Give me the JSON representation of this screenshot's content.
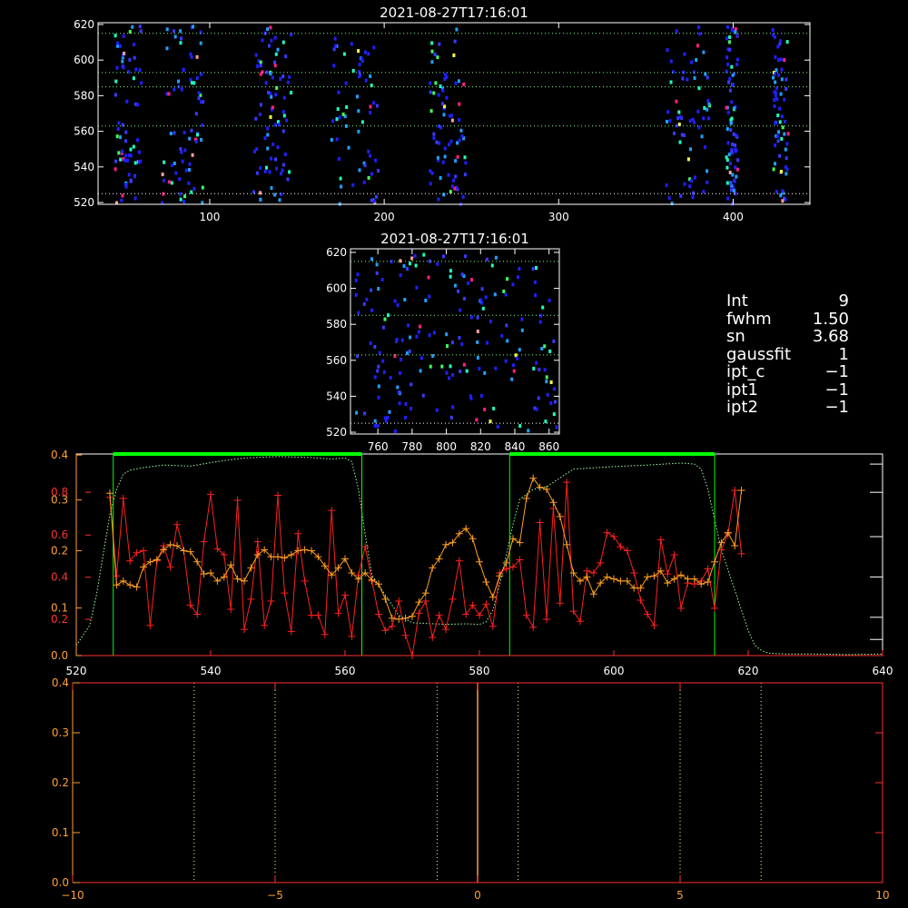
{
  "colors": {
    "background": "#000000",
    "frame": "#ffffff",
    "pixels": [
      "#2020ff",
      "#3a3aff",
      "#20a0ff",
      "#20ffc0",
      "#40ff60",
      "#ff2080",
      "#ffa0a0",
      "#ffff40"
    ],
    "selection_bar": "#00ff00",
    "envelope": "#a0ffa0",
    "red_series": "#ff2020",
    "orange_series": "#ffa020",
    "red_axis": "#ff3030",
    "orange_axis": "#ffa030"
  },
  "info_panel": [
    {
      "key": "Int",
      "value": "9"
    },
    {
      "key": "fwhm",
      "value": "1.50"
    },
    {
      "key": "sn",
      "value": "3.68"
    },
    {
      "key": "gaussfit",
      "value": "1"
    },
    {
      "key": "ipt_c",
      "value": "−1"
    },
    {
      "key": "ipt1",
      "value": "−1"
    },
    {
      "key": "ipt2",
      "value": "−1"
    }
  ],
  "chart_data": [
    {
      "type": "heatmap",
      "title": "2021-08-27T17:16:01",
      "xlim": [
        36,
        444
      ],
      "ylim": [
        519,
        621
      ],
      "x_ticks": [
        100,
        200,
        300,
        400
      ],
      "y_ticks": [
        520,
        540,
        560,
        580,
        600,
        620
      ],
      "hlines": [
        525,
        563,
        585,
        593,
        615
      ],
      "column_bands": [
        [
          45,
          60
        ],
        [
          72,
          96
        ],
        [
          124,
          146
        ],
        [
          169,
          196
        ],
        [
          225,
          246
        ],
        [
          361,
          386
        ],
        [
          395,
          402
        ],
        [
          422,
          431
        ]
      ]
    },
    {
      "type": "heatmap",
      "title": "2021-08-27T17:16:01",
      "xlim": [
        744,
        866
      ],
      "ylim": [
        519,
        622
      ],
      "x_ticks": [
        760,
        780,
        800,
        820,
        840,
        860
      ],
      "y_ticks": [
        520,
        540,
        560,
        580,
        600,
        620
      ],
      "hlines": [
        525,
        563,
        585,
        615
      ]
    },
    {
      "type": "line",
      "xlim": [
        520,
        640
      ],
      "x_ticks": [
        520,
        540,
        560,
        580,
        600,
        620,
        640
      ],
      "left_axis_ticks": [
        {
          "label": "0.4",
          "frac": 0.995
        },
        {
          "label": "0.3",
          "frac": 0.772
        },
        {
          "label": "0.2",
          "frac": 0.52
        },
        {
          "label": "0.1",
          "frac": 0.236
        },
        {
          "label": "0.0",
          "frac": 0.0
        }
      ],
      "left_axis_red_ticks": [
        {
          "label": "0.8",
          "frac": 0.81
        },
        {
          "label": "0.6",
          "frac": 0.598
        },
        {
          "label": "0.4",
          "frac": 0.389
        },
        {
          "label": "0.2",
          "frac": 0.18
        }
      ],
      "selection_windows": [
        [
          525.5,
          562.5
        ],
        [
          584.5,
          615
        ]
      ],
      "envelope": {
        "x": [
          520,
          522,
          523,
          524,
          525,
          526,
          527,
          528,
          530,
          533,
          537,
          541,
          545,
          550,
          555,
          558,
          560,
          561,
          562,
          563,
          564,
          566,
          567,
          568,
          570,
          575,
          578,
          580,
          581,
          582,
          583,
          584,
          585,
          586,
          588,
          590,
          594,
          600,
          605,
          610,
          612,
          613,
          614,
          615,
          616,
          617,
          618,
          619,
          620,
          621,
          622,
          623,
          624,
          626,
          630,
          635,
          640
        ],
        "y": [
          0.02,
          0.06,
          0.12,
          0.2,
          0.28,
          0.33,
          0.36,
          0.368,
          0.373,
          0.378,
          0.376,
          0.385,
          0.392,
          0.395,
          0.393,
          0.39,
          0.392,
          0.385,
          0.33,
          0.24,
          0.16,
          0.12,
          0.1,
          0.08,
          0.065,
          0.062,
          0.063,
          0.062,
          0.067,
          0.09,
          0.14,
          0.2,
          0.26,
          0.31,
          0.33,
          0.335,
          0.37,
          0.375,
          0.378,
          0.382,
          0.38,
          0.37,
          0.33,
          0.27,
          0.21,
          0.17,
          0.13,
          0.09,
          0.05,
          0.02,
          0.01,
          0.005,
          0.004,
          0.003,
          0.003,
          0.002,
          0.003
        ]
      },
      "series": [
        {
          "color_key": "red_series",
          "x": [
            525,
            526,
            527,
            528,
            529,
            530,
            531,
            532,
            533,
            534,
            535,
            536,
            537,
            538,
            539,
            540,
            541,
            542,
            543,
            544,
            545,
            546,
            547,
            548,
            549,
            550,
            551,
            552,
            553,
            554,
            555,
            556,
            557,
            558,
            559,
            560,
            561,
            562,
            563,
            564,
            565,
            566,
            567,
            568,
            569,
            570,
            571,
            572,
            573,
            574,
            575,
            576,
            577,
            578,
            579,
            580,
            581,
            582,
            583,
            584,
            585,
            586,
            587,
            588,
            589,
            590,
            591,
            592,
            593,
            594,
            595,
            596,
            597,
            598,
            599,
            600,
            601,
            602,
            603,
            604,
            605,
            606,
            607,
            608,
            609,
            610,
            611,
            612,
            613,
            614,
            615,
            616,
            617,
            618,
            619
          ],
          "y": [
            0.785,
            0.395,
            0.78,
            0.47,
            0.51,
            0.52,
            0.15,
            0.47,
            0.545,
            0.44,
            0.65,
            0.52,
            0.25,
            0.205,
            0.565,
            0.8,
            0.53,
            0.5,
            0.23,
            0.77,
            0.13,
            0.28,
            0.565,
            0.15,
            0.27,
            0.795,
            0.31,
            0.12,
            0.605,
            0.37,
            0.2,
            0.2,
            0.105,
            0.72,
            0.21,
            0.3,
            0.095,
            0.4,
            0.54,
            0.37,
            0.205,
            0.125,
            0.145,
            0.27,
            0.1,
            0.0,
            0.21,
            0.27,
            0.09,
            0.2,
            0.13,
            0.28,
            0.47,
            0.205,
            0.25,
            0.2,
            0.255,
            0.145,
            0.41,
            0.43,
            0.44,
            0.475,
            0.2,
            0.14,
            0.66,
            0.18,
            0.73,
            0.26,
            0.86,
            0.22,
            0.17,
            0.42,
            0.41,
            0.46,
            0.61,
            0.59,
            0.54,
            0.52,
            0.41,
            0.275,
            0.205,
            0.15,
            0.575,
            0.405,
            0.5,
            0.235,
            0.36,
            0.355,
            0.37,
            0.43,
            0.235,
            0.525,
            0.605,
            0.82,
            0.505
          ]
        },
        {
          "color_key": "orange_series",
          "x": [
            525,
            526,
            527,
            528,
            529,
            530,
            531,
            532,
            533,
            534,
            535,
            536,
            537,
            538,
            539,
            540,
            541,
            542,
            543,
            544,
            545,
            546,
            547,
            548,
            549,
            550,
            551,
            552,
            553,
            554,
            555,
            556,
            557,
            558,
            559,
            560,
            561,
            562,
            563,
            564,
            565,
            566,
            567,
            568,
            569,
            570,
            571,
            572,
            573,
            574,
            575,
            576,
            577,
            578,
            579,
            580,
            581,
            582,
            583,
            584,
            585,
            586,
            587,
            588,
            589,
            590,
            591,
            592,
            593,
            594,
            595,
            596,
            597,
            598,
            599,
            600,
            601,
            602,
            603,
            604,
            605,
            606,
            607,
            608,
            609,
            610,
            611,
            612,
            613,
            614,
            615,
            616,
            617,
            618,
            619
          ],
          "y": [
            0.805,
            0.35,
            0.37,
            0.35,
            0.34,
            0.44,
            0.465,
            0.475,
            0.525,
            0.55,
            0.545,
            0.52,
            0.515,
            0.465,
            0.405,
            0.41,
            0.37,
            0.39,
            0.45,
            0.38,
            0.37,
            0.435,
            0.5,
            0.525,
            0.49,
            0.49,
            0.485,
            0.5,
            0.52,
            0.525,
            0.52,
            0.49,
            0.445,
            0.4,
            0.435,
            0.48,
            0.41,
            0.38,
            0.41,
            0.375,
            0.355,
            0.28,
            0.185,
            0.18,
            0.185,
            0.195,
            0.265,
            0.31,
            0.435,
            0.48,
            0.55,
            0.56,
            0.605,
            0.63,
            0.58,
            0.465,
            0.365,
            0.29,
            0.395,
            0.46,
            0.58,
            0.56,
            0.78,
            0.88,
            0.835,
            0.825,
            0.76,
            0.69,
            0.55,
            0.41,
            0.37,
            0.39,
            0.305,
            0.36,
            0.39,
            0.38,
            0.37,
            0.37,
            0.335,
            0.335,
            0.39,
            0.395,
            0.42,
            0.36,
            0.38,
            0.4,
            0.38,
            0.38,
            0.355,
            0.365,
            0.465,
            0.56,
            0.61,
            0.545,
            0.82
          ]
        }
      ]
    },
    {
      "type": "line",
      "xlim": [
        -10,
        10
      ],
      "ylim": [
        0,
        0.4
      ],
      "x_ticks": [
        -10,
        -5,
        0,
        5,
        10
      ],
      "x_tick_labels": [
        "−10",
        "−5",
        "0",
        "5",
        "10"
      ],
      "y_ticks": [
        0.0,
        0.1,
        0.2,
        0.3,
        0.4
      ],
      "y_tick_labels": [
        "0.0",
        "0.1",
        "0.2",
        "0.3",
        "0.4"
      ],
      "dotted_vlines": [
        -7,
        -5,
        -1,
        1,
        5,
        7
      ],
      "solid_vline": 0
    }
  ]
}
